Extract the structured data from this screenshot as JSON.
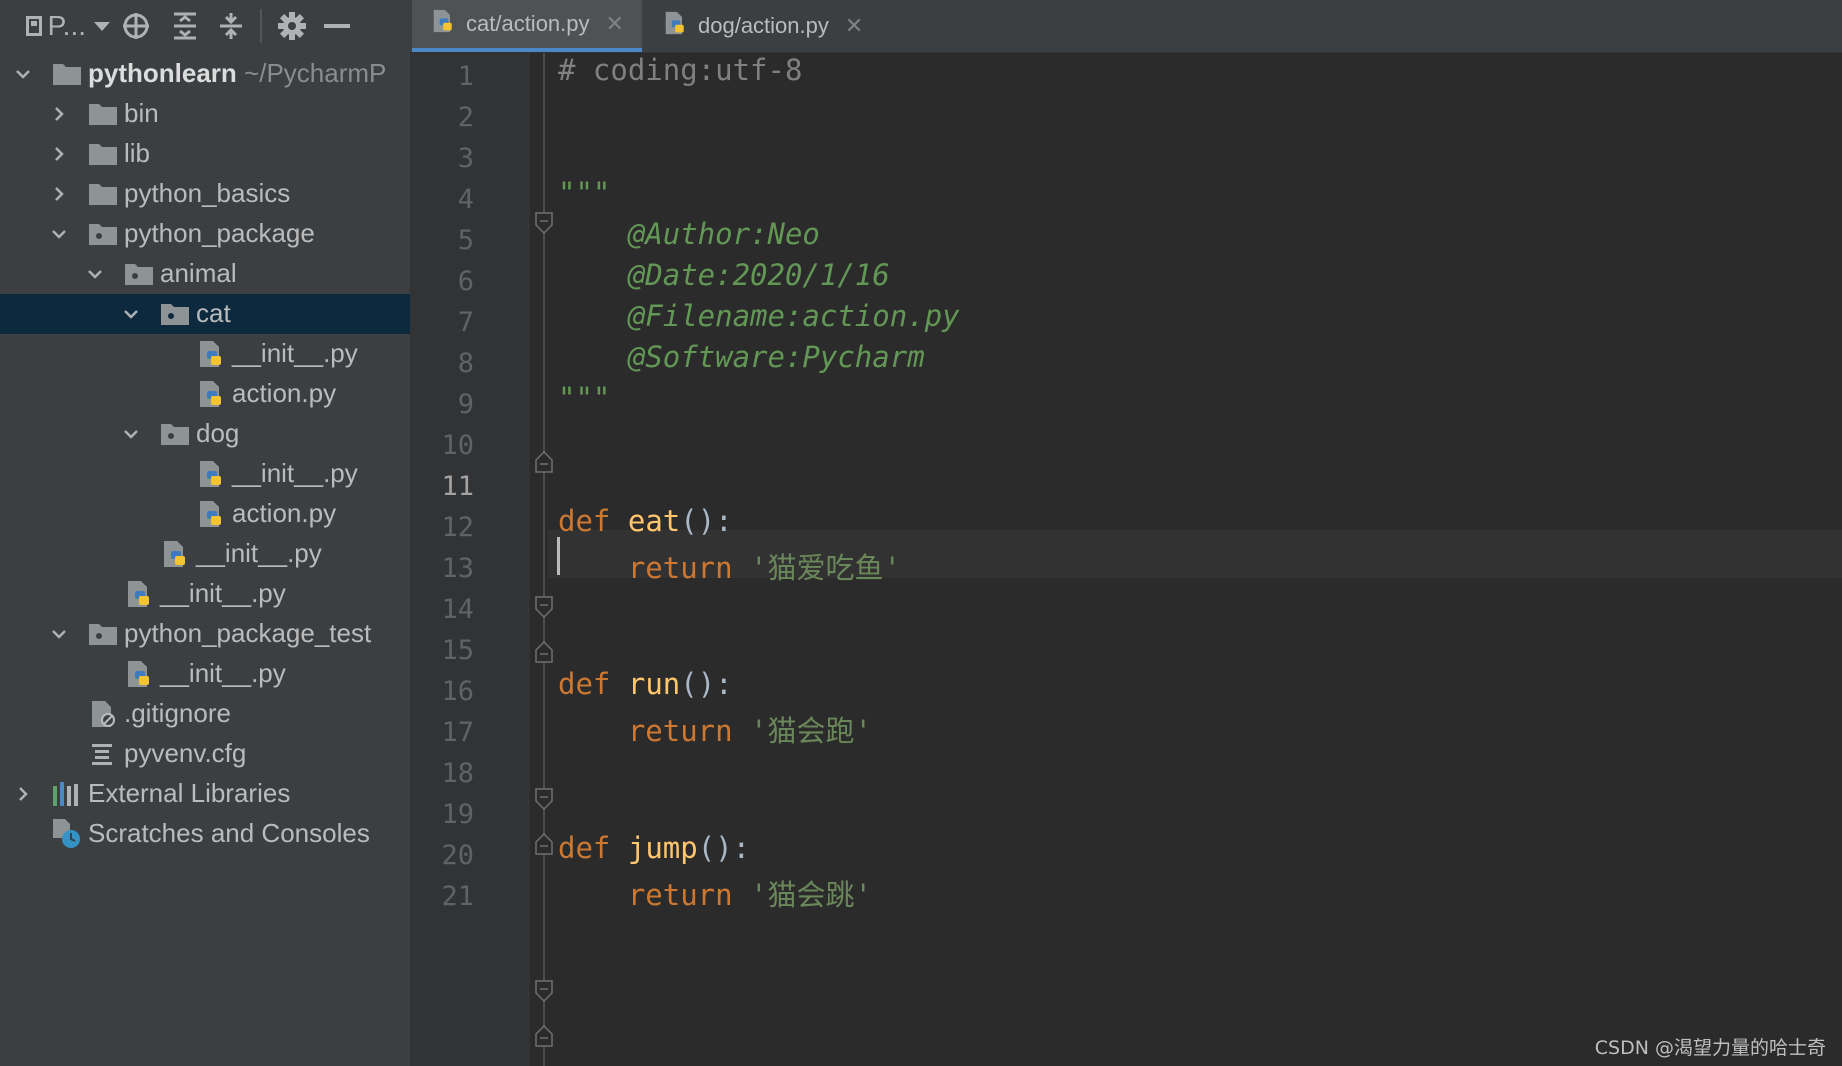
{
  "toolbar": {
    "project_switch_label": "P..."
  },
  "tree": {
    "root_name": "pythonlearn",
    "root_path": "~/PycharmP",
    "items": [
      {
        "label": "bin"
      },
      {
        "label": "lib"
      },
      {
        "label": "python_basics"
      },
      {
        "label": "python_package"
      },
      {
        "label": "animal"
      },
      {
        "label": "cat"
      },
      {
        "label": "__init__.py"
      },
      {
        "label": "action.py"
      },
      {
        "label": "dog"
      },
      {
        "label": "__init__.py"
      },
      {
        "label": "action.py"
      },
      {
        "label": "__init__.py"
      },
      {
        "label": "__init__.py"
      },
      {
        "label": "python_package_test"
      },
      {
        "label": "__init__.py"
      },
      {
        "label": ".gitignore"
      },
      {
        "label": "pyvenv.cfg"
      },
      {
        "label": "External Libraries"
      },
      {
        "label": "Scratches and Consoles"
      }
    ]
  },
  "tabs": [
    {
      "label": "cat/action.py",
      "active": true
    },
    {
      "label": "dog/action.py",
      "active": false
    }
  ],
  "editor": {
    "line_numbers": [
      "1",
      "2",
      "3",
      "4",
      "5",
      "6",
      "7",
      "8",
      "9",
      "10",
      "11",
      "12",
      "13",
      "14",
      "15",
      "16",
      "17",
      "18",
      "19",
      "20",
      "21"
    ],
    "current_line": "11",
    "code": {
      "l1": "# coding:utf-8",
      "l4": "\"\"\"",
      "l5": "    @Author:Neo",
      "l6": "    @Date:2020/1/16",
      "l7": "    @Filename:action.py",
      "l8": "    @Software:Pycharm",
      "l9": "\"\"\"",
      "def_kw": "def",
      "return_kw": "return",
      "fn_eat": "eat",
      "fn_run": "run",
      "fn_jump": "jump",
      "sig_tail": "():",
      "str_eat": "'猫爱吃鱼'",
      "str_run": "'猫会跑'",
      "str_jump": "'猫会跳'"
    }
  },
  "watermark": "CSDN @渴望力量的哈士奇",
  "colors": {
    "panel_bg": "#3c3f41",
    "editor_bg": "#2b2b2b",
    "selection": "#0d293e",
    "keyword": "#cc7832",
    "function": "#ffc66d",
    "string": "#6a8759",
    "docstring": "#629755",
    "comment": "#808080",
    "tab_underline": "#4a88c7"
  }
}
